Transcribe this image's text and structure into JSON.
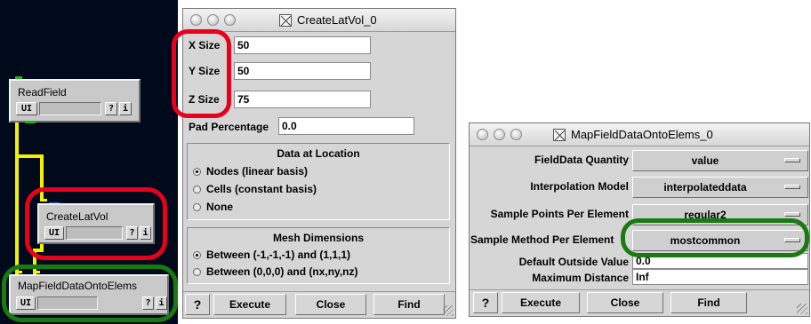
{
  "network": {
    "modules": [
      {
        "title": "ReadField",
        "ui_label": "UI",
        "help_label": "?",
        "info_label": "i"
      },
      {
        "title": "CreateLatVol",
        "ui_label": "UI",
        "help_label": "?",
        "info_label": "i"
      },
      {
        "title": "MapFieldDataOntoElems",
        "ui_label": "UI",
        "help_label": "?",
        "info_label": "i"
      }
    ]
  },
  "createlatvol": {
    "title": "CreateLatVol_0",
    "x_size": {
      "label": "X Size",
      "value": "50"
    },
    "y_size": {
      "label": "Y Size",
      "value": "50"
    },
    "z_size": {
      "label": "Z Size",
      "value": "75"
    },
    "pad": {
      "label": "Pad Percentage",
      "value": "0.0"
    },
    "data_location": {
      "title": "Data at Location",
      "options": [
        "Nodes (linear basis)",
        "Cells (constant basis)",
        "None"
      ],
      "selected": "Nodes (linear basis)"
    },
    "mesh_dimensions": {
      "title": "Mesh Dimensions",
      "options": [
        "Between (-1,-1,-1) and (1,1,1)",
        "Between (0,0,0) and (nx,ny,nz)"
      ],
      "selected": "Between (-1,-1,-1) and (1,1,1)"
    },
    "buttons": {
      "help": "?",
      "execute": "Execute",
      "close": "Close",
      "find": "Find"
    }
  },
  "mapfield": {
    "title": "MapFieldDataOntoElems_0",
    "rows": [
      {
        "label": "FieldData Quantity",
        "value": "value"
      },
      {
        "label": "Interpolation Model",
        "value": "interpolateddata"
      },
      {
        "label": "Sample Points Per Element",
        "value": "regular2"
      },
      {
        "label": "Sample Method Per Element",
        "value": "mostcommon"
      }
    ],
    "default_outside": {
      "label": "Default Outside Value",
      "value": "0.0"
    },
    "max_distance": {
      "label": "Maximum Distance",
      "value": "Inf"
    },
    "buttons": {
      "help": "?",
      "execute": "Execute",
      "close": "Close",
      "find": "Find"
    }
  },
  "colors": {
    "highlight_red": "#e8001c",
    "highlight_green": "#1a7a12",
    "pipe": "#f2f200",
    "canvas": "#000a1a"
  }
}
